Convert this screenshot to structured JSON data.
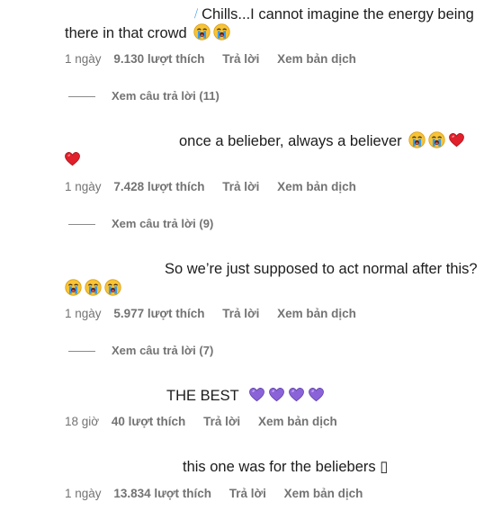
{
  "comments": [
    {
      "line1": "Chills...I cannot imagine the energy being",
      "line2": "there in that crowd",
      "time": "1 ngày",
      "likes": "9.130 lượt thích",
      "reply": "Trả lời",
      "translate": "Xem bản dịch",
      "view_replies": "Xem câu trả lời (11)",
      "emojis": [
        "crying-face",
        "crying-face"
      ]
    },
    {
      "line1": "once a belieber, always a believer",
      "time": "1 ngày",
      "likes": "7.428 lượt thích",
      "reply": "Trả lời",
      "translate": "Xem bản dịch",
      "view_replies": "Xem câu trả lời (9)",
      "emojis": [
        "crying-face",
        "crying-face",
        "red-heart",
        "red-heart"
      ]
    },
    {
      "line1": "So we’re just supposed to act normal after this?",
      "time": "1 ngày",
      "likes": "5.977 lượt thích",
      "reply": "Trả lời",
      "translate": "Xem bản dịch",
      "view_replies": "Xem câu trả lời (7)",
      "emojis": [
        "crying-face",
        "crying-face",
        "crying-face"
      ]
    },
    {
      "line1": "THE BEST",
      "time": "18 giờ",
      "likes": "40 lượt thích",
      "reply": "Trả lời",
      "translate": "Xem bản dịch",
      "emojis": [
        "purple-heart",
        "purple-heart",
        "purple-heart",
        "purple-heart"
      ]
    },
    {
      "line1": "this one was for the beliebers ▯",
      "time": "1 ngày",
      "likes": "13.834 lượt thích",
      "reply": "Trả lời",
      "translate": "Xem bản dịch",
      "emojis": []
    }
  ],
  "colors": {
    "text": "#1c1c1c",
    "meta": "#737373",
    "crying_face": "#f7c436",
    "tear": "#3b9be8",
    "red_heart": "#e0202b",
    "purple_heart": "#8b63d8"
  }
}
